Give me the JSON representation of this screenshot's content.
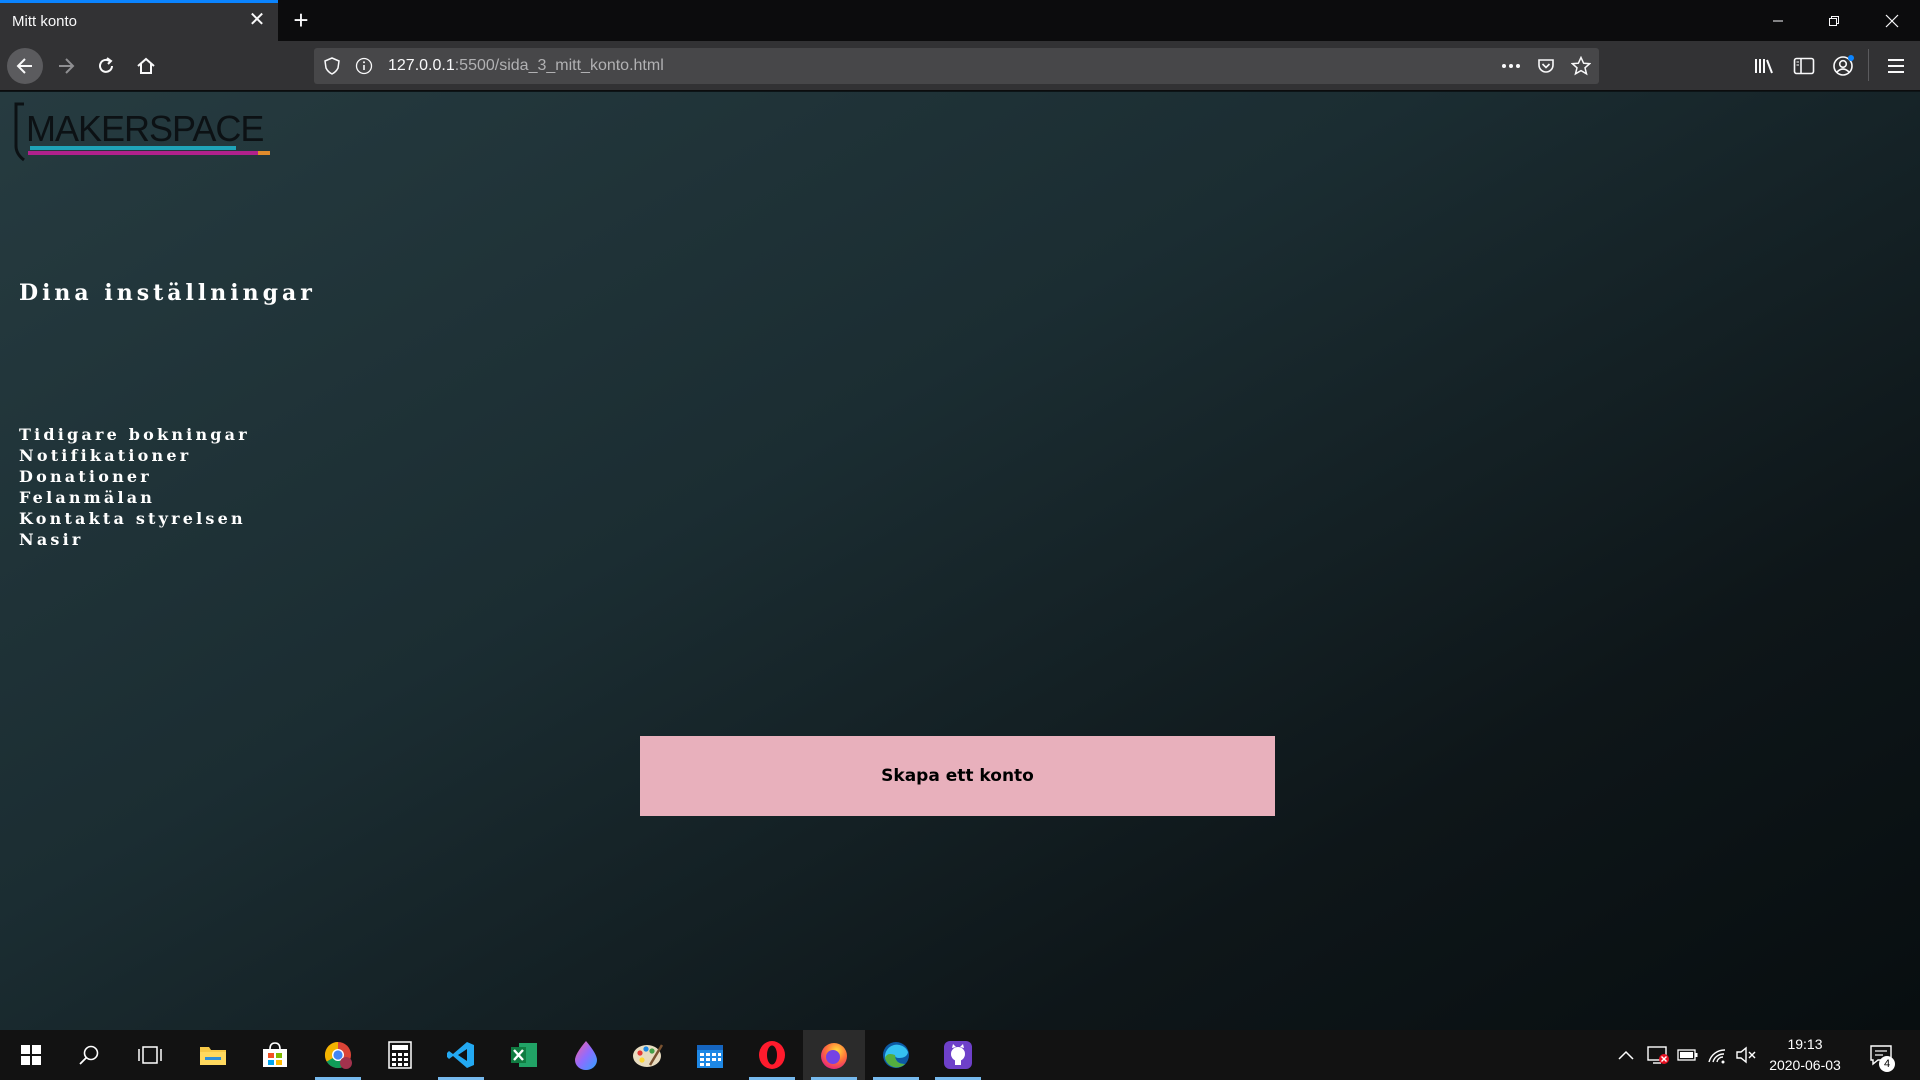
{
  "browser": {
    "tab_title": "Mitt konto",
    "url_host": "127.0.0.1",
    "url_path": ":5500/sida_3_mitt_konto.html"
  },
  "page": {
    "logo_text": "MAKERSPACE",
    "heading": "Dina inställningar",
    "menu": [
      {
        "label": "Tidigare bokningar"
      },
      {
        "label": "Notifikationer"
      },
      {
        "label": "Donationer"
      },
      {
        "label": "Felanmälan"
      },
      {
        "label": "Kontakta styrelsen"
      },
      {
        "label": "Nasir"
      }
    ],
    "cta_label": "Skapa ett konto"
  },
  "taskbar": {
    "apps": [
      "start-icon",
      "search-icon",
      "task-view-icon",
      "file-explorer-icon",
      "store-icon",
      "chrome-icon",
      "calculator-icon",
      "vscode-icon",
      "excel-icon",
      "paint3d-icon",
      "paint-icon",
      "calendar-icon",
      "opera-icon",
      "firefox-icon",
      "edge-icon",
      "github-desktop-icon"
    ],
    "time": "19:13",
    "date": "2020-06-03",
    "notification_count": "4"
  },
  "colors": {
    "accent": "#0a84ff",
    "cta_background": "#e8b0bc",
    "logo_cyan": "#1fa3b8",
    "logo_magenta": "#b0218c",
    "logo_orange": "#e08b2c"
  }
}
